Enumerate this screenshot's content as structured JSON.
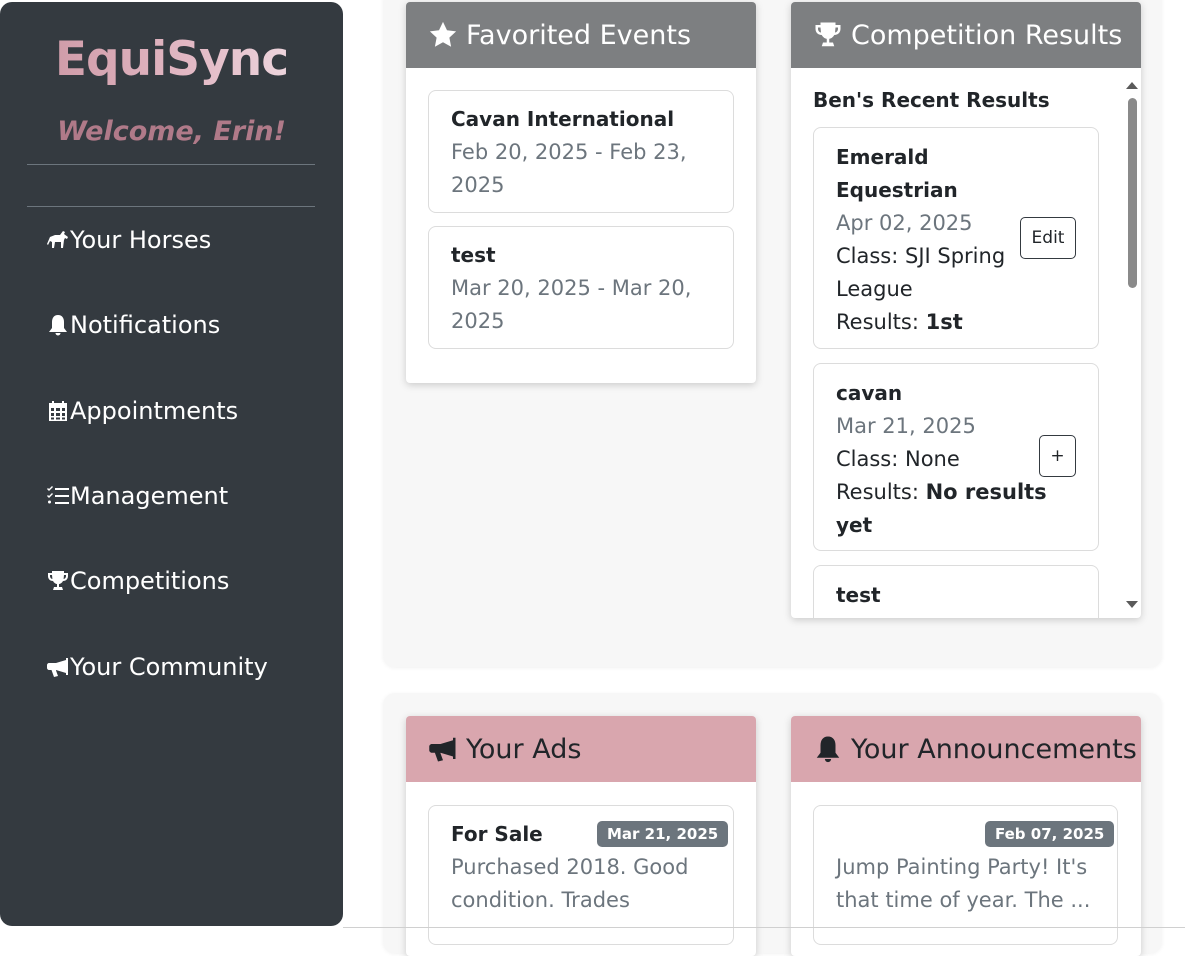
{
  "app": {
    "brand": "EquiSync",
    "welcome": "Welcome, Erin!"
  },
  "sidebar": {
    "items": [
      {
        "label": "Your Horses",
        "icon": "horse-icon"
      },
      {
        "label": "Notifications",
        "icon": "bell-icon"
      },
      {
        "label": "Appointments",
        "icon": "calendar-icon"
      },
      {
        "label": "Management",
        "icon": "list-check-icon"
      },
      {
        "label": "Competitions",
        "icon": "trophy-icon"
      },
      {
        "label": "Your Community",
        "icon": "bullhorn-icon"
      }
    ]
  },
  "favorited_events": {
    "title": "Favorited Events",
    "events": [
      {
        "name": "Cavan International",
        "dates_line1": "Feb 20, 2025 - Feb 23,",
        "dates_line2": "2025"
      },
      {
        "name": "test",
        "dates_line1": "Mar 20, 2025 - Mar 20,",
        "dates_line2": "2025"
      }
    ]
  },
  "competition_results": {
    "title": "Competition Results",
    "subtitle": "Ben's Recent Results",
    "results": [
      {
        "name_line1": "Emerald",
        "name_line2": "Equestrian",
        "date": "Apr 02, 2025",
        "class_line1": "Class: SJI Spring",
        "class_line2": "League",
        "results_label": "Results: ",
        "results_value": "1st",
        "button": "Edit"
      },
      {
        "name_line1": "cavan",
        "date": "Mar 21, 2025",
        "class_line1": "Class: None",
        "results_label": "Results: ",
        "results_value_line1": "No results",
        "results_value_line2": "yet",
        "button": "+"
      },
      {
        "name_line1": "test"
      }
    ]
  },
  "your_ads": {
    "title": "Your Ads",
    "ads": [
      {
        "title": "For Sale",
        "date": "Mar 21, 2025",
        "text_line1": "Purchased 2018. Good",
        "text_line2": "condition. Trades"
      }
    ]
  },
  "your_announcements": {
    "title": "Your Announcements",
    "items": [
      {
        "date": "Feb 07, 2025",
        "text_line1": "Jump Painting Party! It's",
        "text_line2": "that time of year. The ..."
      }
    ]
  },
  "colors": {
    "sidebar_bg": "#343a40",
    "header_gray": "#7d7f81",
    "header_pink": "#d9a6ae",
    "badge_bg": "#6c757d",
    "brand_accent": "#c8919e"
  }
}
